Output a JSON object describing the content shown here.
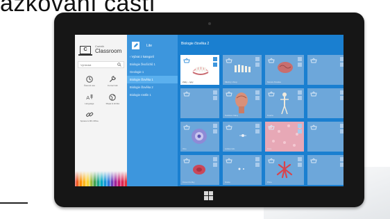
{
  "page_heading": "ažkování částí",
  "app": {
    "brand_small": "Corinth",
    "brand_big": "Classroom",
    "logo_letter": "C",
    "search_placeholder": "Vyhledat",
    "tools": [
      {
        "label": "Časová osa",
        "icon": "history-icon"
      },
      {
        "label": "Correct lab",
        "icon": "wrench-icon"
      },
      {
        "label": "Language",
        "icon": "translate-icon"
      },
      {
        "label": "Mapa & sbírka",
        "icon": "globe-icon"
      },
      {
        "label": "Správa & MS Office",
        "icon": "link-icon"
      }
    ]
  },
  "categories": {
    "product": "Lite",
    "items": [
      {
        "label": "‹ Vybrat z kategorií",
        "state": "select"
      },
      {
        "label": "Biologie živočichů 1",
        "state": "normal"
      },
      {
        "label": "Geologie 1",
        "state": "normal"
      },
      {
        "label": "Biologie člověka 1",
        "state": "active"
      },
      {
        "label": "Biologie člověka 2",
        "state": "normal"
      },
      {
        "label": "Biologie rostlin 1",
        "state": "normal"
      }
    ]
  },
  "gallery": {
    "title": "Biologie člověka 2",
    "tiles": [
      {
        "caption": "Zuby – typy",
        "thumb": "teeth"
      },
      {
        "caption": "Mléčný chrup",
        "thumb": "small-teeth"
      },
      {
        "caption": "Mozek člověka",
        "thumb": "brain"
      },
      {
        "caption": "",
        "thumb": "none"
      },
      {
        "caption": "",
        "thumb": "none"
      },
      {
        "caption": "Svalstvo hlavy",
        "thumb": "head"
      },
      {
        "caption": "Kostra",
        "thumb": "skeleton"
      },
      {
        "caption": "",
        "thumb": "none"
      },
      {
        "caption": "Oko",
        "thumb": "eye"
      },
      {
        "caption": "Lidské tělo",
        "thumb": "body"
      },
      {
        "caption": "Krev",
        "thumb": "blood"
      },
      {
        "caption": "",
        "thumb": "none"
      },
      {
        "caption": "Krevní buňky",
        "thumb": "cell"
      },
      {
        "caption": "Srdce",
        "thumb": "dots"
      },
      {
        "caption": "Plíce",
        "thumb": "lungs"
      },
      {
        "caption": "",
        "thumb": "none"
      }
    ]
  },
  "colors": {
    "screen_blue": "#1b7fd0",
    "panel_blue": "#3d96dd",
    "active_item": "#5bb0ee",
    "tile": "#6da7da",
    "bezel": "#161616"
  }
}
